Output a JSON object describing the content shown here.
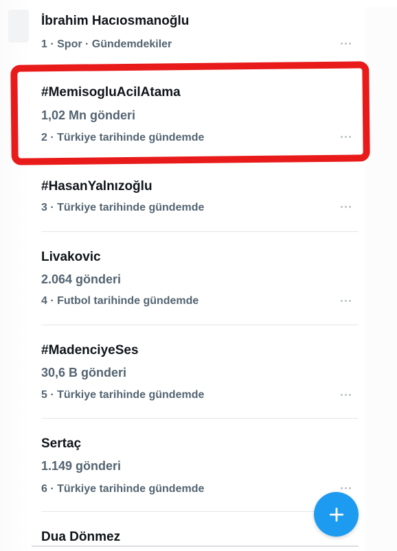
{
  "trends": [
    {
      "rank_meta": "",
      "name": "İbrahim Hacıosmanoğlu",
      "count": "",
      "meta": "1 · Spor · Gündemdekiler"
    },
    {
      "name": "#MemisogluAcilAtama",
      "count": "1,02 Mn gönderi",
      "meta": "2 · Türkiye tarihinde gündemde"
    },
    {
      "name": "#HasanYalnızoğlu",
      "count": "",
      "meta": "3 · Türkiye tarihinde gündemde"
    },
    {
      "name": "Livakovic",
      "count": "2.064 gönderi",
      "meta": "4 · Futbol tarihinde gündemde"
    },
    {
      "name": "#MadenciyeSes",
      "count": "30,6 B gönderi",
      "meta": "5 · Türkiye tarihinde gündemde"
    },
    {
      "name": "Sertaç",
      "count": "1.149 gönderi",
      "meta": "6 · Türkiye tarihinde gündemde"
    },
    {
      "name": "Dua Dönmez",
      "count": "",
      "meta": ""
    }
  ],
  "colors": {
    "accent": "#1d9bf0",
    "highlight": "#e81a1a",
    "text_primary": "#0f1419",
    "text_secondary": "#536471"
  },
  "icons": {
    "more": "more-horizontal-icon",
    "fab": "plus-icon"
  }
}
